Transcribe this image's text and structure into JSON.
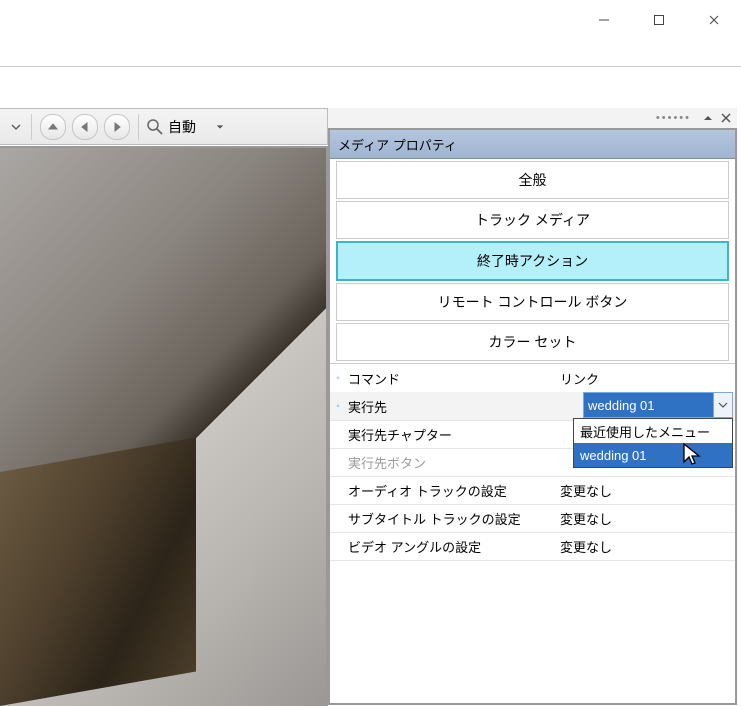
{
  "window": {
    "minimize": "minimize",
    "maximize": "maximize",
    "close": "close"
  },
  "toolbar": {
    "zoom_label": "自動"
  },
  "panel": {
    "title": "メディア プロパティ",
    "tabs": {
      "general": "全般",
      "track_media": "トラック メディア",
      "end_action": "終了時アクション",
      "remote": "リモート コントロール ボタン",
      "color_set": "カラー セット"
    }
  },
  "props": {
    "rows": [
      {
        "label": "コマンド",
        "value": "リンク",
        "dim": false,
        "dot": true
      },
      {
        "label": "実行先",
        "value": "wedding 01",
        "dim": false,
        "dot": true
      },
      {
        "label": "実行先チャプター",
        "value": "",
        "dim": false,
        "dot": false
      },
      {
        "label": "実行先ボタン",
        "value": "",
        "dim": true,
        "dot": false
      },
      {
        "label": "オーディオ トラックの設定",
        "value": "変更なし",
        "dim": false,
        "dot": false
      },
      {
        "label": "サブタイトル トラックの設定",
        "value": "変更なし",
        "dim": false,
        "dot": false
      },
      {
        "label": "ビデオ アングルの設定",
        "value": "変更なし",
        "dim": false,
        "dot": false
      }
    ]
  },
  "combo": {
    "selected": "wedding 01",
    "options": [
      {
        "label": "最近使用したメニュー",
        "hi": false
      },
      {
        "label": "wedding 01",
        "hi": true
      }
    ]
  }
}
